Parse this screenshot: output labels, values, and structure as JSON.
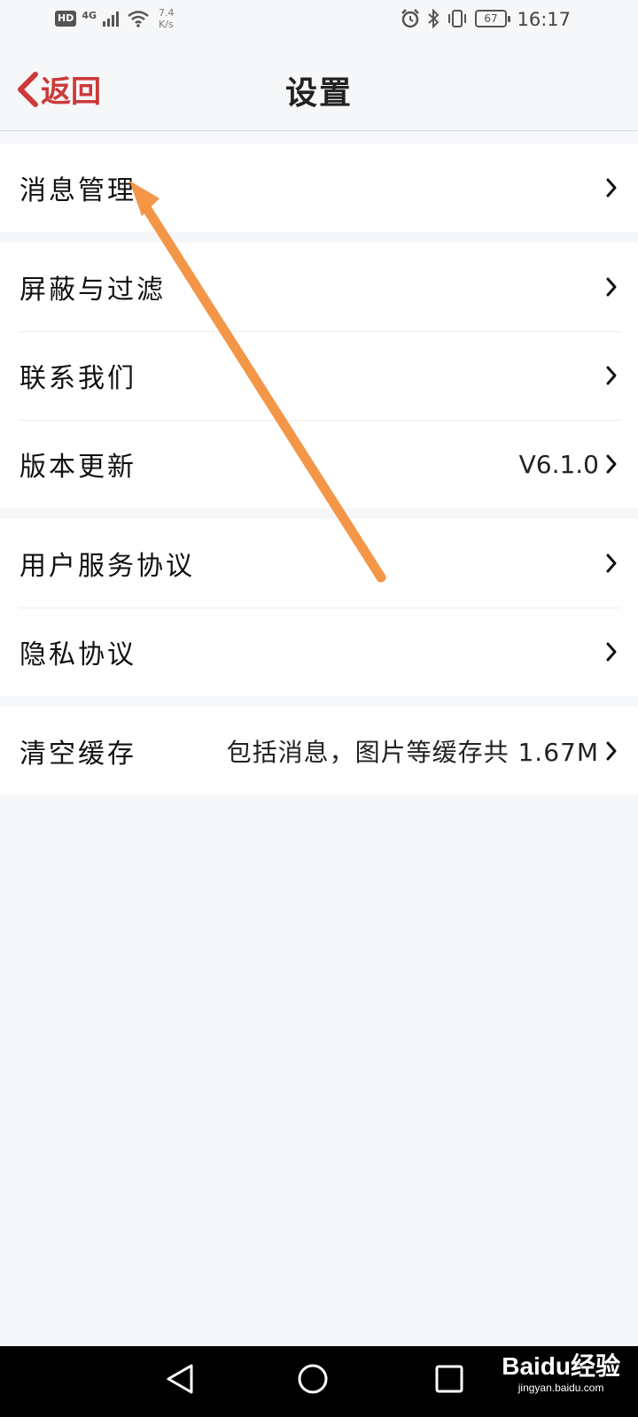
{
  "status_bar": {
    "hd": "HD",
    "network": "4G",
    "speed_value": "7.4",
    "speed_unit": "K/s",
    "battery": "67",
    "time": "16:17"
  },
  "nav": {
    "back_label": "返回",
    "title": "设置",
    "accent_color": "#cc3a3a"
  },
  "groups": [
    {
      "items": [
        {
          "label": "消息管理",
          "value": ""
        }
      ]
    },
    {
      "items": [
        {
          "label": "屏蔽与过滤",
          "value": ""
        },
        {
          "label": "联系我们",
          "value": ""
        },
        {
          "label": "版本更新",
          "value": "V6.1.0"
        }
      ]
    },
    {
      "items": [
        {
          "label": "用户服务协议",
          "value": ""
        },
        {
          "label": "隐私协议",
          "value": ""
        }
      ]
    },
    {
      "items": [
        {
          "label": "清空缓存",
          "value": "包括消息，图片等缓存共 1.67M"
        }
      ]
    }
  ],
  "annotation": {
    "arrow_color": "#f4913f",
    "icon": "arrow-annotation-icon"
  },
  "watermark": {
    "logo": "Baidu经验",
    "url": "jingyan.baidu.com"
  }
}
